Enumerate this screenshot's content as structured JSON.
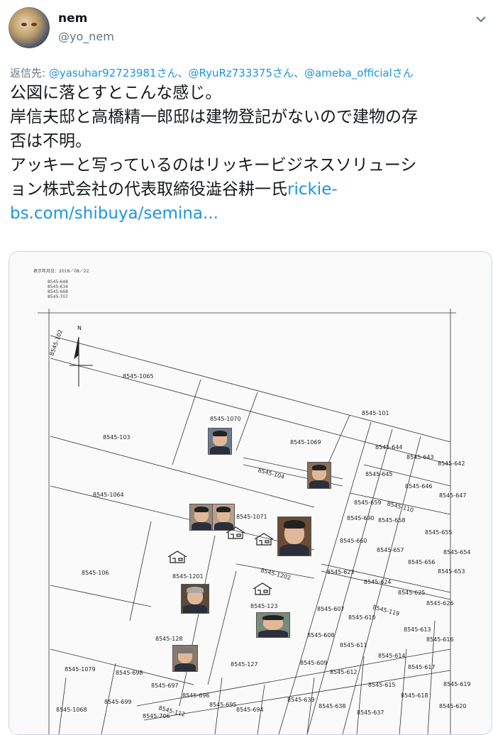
{
  "user": {
    "name": "nem",
    "handle": "@yo_nem"
  },
  "reply": {
    "prefix": "返信先:",
    "mention1": "@yasuhar92723981さん",
    "sep1": "、",
    "mention2": "@RyuRz733375さん",
    "sep2": "、",
    "mention3": "@ameba_officialさん"
  },
  "tweet": {
    "line1": "公図に落とすとこんな感じ。",
    "line2": "岸信夫邸と高橋精一郎邸は建物登記がないので建物の存",
    "line3": "否は不明。",
    "line4": "アッキーと写っているのはリッキービジネスソリューシ",
    "line5_text": "ョン株式会社の代表取締役澁谷耕一氏",
    "line5_link": "rickie-",
    "line6_link": "bs.com/shibuya/semina..."
  },
  "map": {
    "header_date": "表示年月日：2018／08／22",
    "header_codes": [
      "8545-648",
      "8545-634",
      "8545-668",
      "8545-707"
    ],
    "north": "N",
    "parcels": [
      {
        "label": "8545-102"
      },
      {
        "label": "8545-1065"
      },
      {
        "label": "8545-1070"
      },
      {
        "label": "8545-103"
      },
      {
        "label": "8545-1069"
      },
      {
        "label": "8545-101"
      },
      {
        "label": "8545-644"
      },
      {
        "label": "8545-643"
      },
      {
        "label": "8545-642"
      },
      {
        "label": "8545-645"
      },
      {
        "label": "8545-104"
      },
      {
        "label": "8545-646"
      },
      {
        "label": "8545-647"
      },
      {
        "label": "8545-1064"
      },
      {
        "label": "8545-659"
      },
      {
        "label": "8545-110"
      },
      {
        "label": "8545-1071"
      },
      {
        "label": "8545-690"
      },
      {
        "label": "8545-658"
      },
      {
        "label": "8545-655"
      },
      {
        "label": "8545-660"
      },
      {
        "label": "8545-657"
      },
      {
        "label": "8545-656"
      },
      {
        "label": "8545-106"
      },
      {
        "label": "8545-1202"
      },
      {
        "label": "8545-623"
      },
      {
        "label": "8545-653"
      },
      {
        "label": "8545-1201"
      },
      {
        "label": "8545-624"
      },
      {
        "label": "8545-625"
      },
      {
        "label": "8545-626"
      },
      {
        "label": "8545-123"
      },
      {
        "label": "8545-607"
      },
      {
        "label": "8545-119"
      },
      {
        "label": "8545-610"
      },
      {
        "label": "8545-613"
      },
      {
        "label": "8545-608"
      },
      {
        "label": "8545-616"
      },
      {
        "label": "8545-128"
      },
      {
        "label": "8545-611"
      },
      {
        "label": "8545-614"
      },
      {
        "label": "8545-127"
      },
      {
        "label": "8545-609"
      },
      {
        "label": "8545-617"
      },
      {
        "label": "8545-1079"
      },
      {
        "label": "8545-698"
      },
      {
        "label": "8545-612"
      },
      {
        "label": "8545-697"
      },
      {
        "label": "8545-615"
      },
      {
        "label": "8545-618"
      },
      {
        "label": "8545-696"
      },
      {
        "label": "8545-699"
      },
      {
        "label": "8545-695"
      },
      {
        "label": "8545-639"
      },
      {
        "label": "8545-620"
      },
      {
        "label": "8545-112"
      },
      {
        "label": "8545-694"
      },
      {
        "label": "8545-638"
      },
      {
        "label": "8545-1068"
      },
      {
        "label": "8545-706"
      },
      {
        "label": "8545-637"
      },
      {
        "label": "8545-654"
      },
      {
        "label": "8545-619"
      }
    ]
  }
}
